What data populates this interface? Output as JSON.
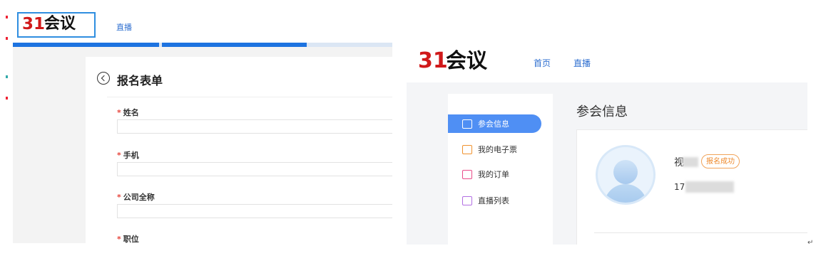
{
  "left": {
    "logo": {
      "mark": "31",
      "word": "会议"
    },
    "nav": {
      "live": "直播"
    },
    "form": {
      "title": "报名表单",
      "required_mark": "*",
      "fields": [
        {
          "label": "姓名",
          "value": ""
        },
        {
          "label": "手机",
          "value": ""
        },
        {
          "label": "公司全称",
          "value": ""
        },
        {
          "label": "职位",
          "value": ""
        }
      ]
    }
  },
  "right": {
    "logo": {
      "mark": "31",
      "word": "会议"
    },
    "nav": {
      "home": "首页",
      "live": "直播"
    },
    "sidebar": {
      "items": [
        {
          "label": "参会信息",
          "icon": "id-card-icon",
          "color": "#4f8ff4",
          "active": true
        },
        {
          "label": "我的电子票",
          "icon": "ticket-icon",
          "color": "#f0922e",
          "active": false
        },
        {
          "label": "我的订单",
          "icon": "order-icon",
          "color": "#ea4c89",
          "active": false
        },
        {
          "label": "直播列表",
          "icon": "tv-icon",
          "color": "#b26fe3",
          "active": false
        }
      ]
    },
    "section_title": "参会信息",
    "attendee": {
      "name_prefix": "视",
      "phone_prefix": "17",
      "status_badge": "报名成功"
    }
  },
  "misc": {
    "return_mark": "↵"
  },
  "colors": {
    "accent_blue": "#1d73e0",
    "brand_red": "#d0191a",
    "badge_orange": "#ee8a2d"
  }
}
